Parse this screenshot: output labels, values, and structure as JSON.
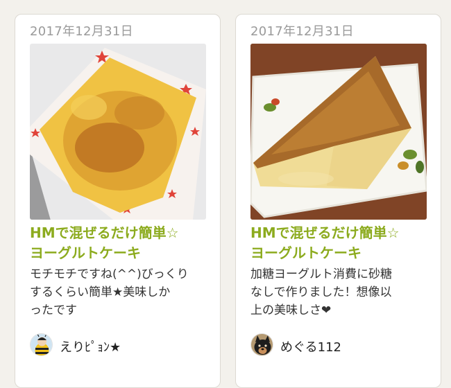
{
  "cards": [
    {
      "date": "2017年12月31日",
      "photo_icon": "cheesecake-in-square-pan",
      "title_line1": "HMで混ぜるだけ簡単☆",
      "title_line2": "ヨーグルトケーキ",
      "desc_lines": [
        "モチモチですね(^^)びっくり",
        "するくらい簡単★美味しか",
        "ったです"
      ],
      "author_name": "えりﾋﾟｮﾝ★",
      "avatar_icon": "bee-costume-avatar"
    },
    {
      "date": "2017年12月31日",
      "photo_icon": "cake-slice-on-plate",
      "title_line1": "HMで混ぜるだけ簡単☆",
      "title_line2": "ヨーグルトケーキ",
      "desc_lines": [
        "加糖ヨーグルト消費に砂糖",
        "なしで作りました！想像以",
        "上の美味しさ❤"
      ],
      "author_name": "めぐる112",
      "avatar_icon": "dog-avatar"
    }
  ],
  "colors": {
    "title_green": "#8cab1e",
    "date_gray": "#9a9a9a",
    "card_border": "#dcd9d2"
  }
}
